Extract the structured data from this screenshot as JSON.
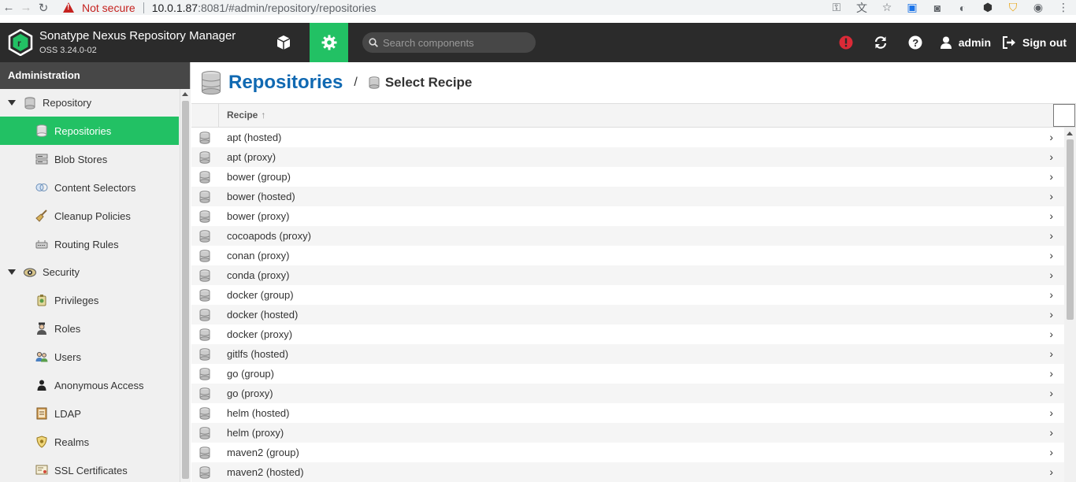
{
  "browser": {
    "security_label": "Not secure",
    "url_host": "10.0.1.87",
    "url_rest": ":8081/#admin/repository/repositories"
  },
  "header": {
    "product": "Sonatype Nexus Repository Manager",
    "version": "OSS 3.24.0-02",
    "search_placeholder": "Search components",
    "user": "admin",
    "signout": "Sign out",
    "accent_color": "#22c164"
  },
  "sidebar": {
    "title": "Administration",
    "items": [
      {
        "label": "Repository",
        "level": "group",
        "icon": "database-icon"
      },
      {
        "label": "Repositories",
        "level": "child",
        "icon": "database-icon",
        "selected": true
      },
      {
        "label": "Blob Stores",
        "level": "child",
        "icon": "server-icon"
      },
      {
        "label": "Content Selectors",
        "level": "child",
        "icon": "selector-icon"
      },
      {
        "label": "Cleanup Policies",
        "level": "child",
        "icon": "broom-icon"
      },
      {
        "label": "Routing Rules",
        "level": "child",
        "icon": "router-icon"
      },
      {
        "label": "Security",
        "level": "group",
        "icon": "eye-icon"
      },
      {
        "label": "Privileges",
        "level": "child",
        "icon": "badge-icon"
      },
      {
        "label": "Roles",
        "level": "child",
        "icon": "role-icon"
      },
      {
        "label": "Users",
        "level": "child",
        "icon": "users-icon"
      },
      {
        "label": "Anonymous Access",
        "level": "child",
        "icon": "person-icon"
      },
      {
        "label": "LDAP",
        "level": "child",
        "icon": "book-icon"
      },
      {
        "label": "Realms",
        "level": "child",
        "icon": "shield-icon"
      },
      {
        "label": "SSL Certificates",
        "level": "child",
        "icon": "certificate-icon"
      }
    ]
  },
  "main": {
    "title": "Repositories",
    "subtitle": "Select Recipe",
    "column_header": "Recipe",
    "sort_indicator": "↑",
    "recipes": [
      "apt (hosted)",
      "apt (proxy)",
      "bower (group)",
      "bower (hosted)",
      "bower (proxy)",
      "cocoapods (proxy)",
      "conan (proxy)",
      "conda (proxy)",
      "docker (group)",
      "docker (hosted)",
      "docker (proxy)",
      "gitlfs (hosted)",
      "go (group)",
      "go (proxy)",
      "helm (hosted)",
      "helm (proxy)",
      "maven2 (group)",
      "maven2 (hosted)"
    ]
  }
}
